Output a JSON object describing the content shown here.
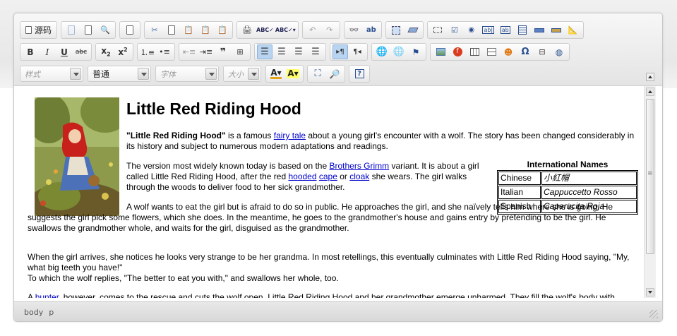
{
  "toolbar": {
    "source_label": "源码",
    "format_combo": "样式",
    "paragraph_combo": "普通",
    "font_combo": "字体",
    "size_combo": "大小"
  },
  "content": {
    "title": "Little Red Riding Hood",
    "p1": {
      "bold": "\"Little Red Riding Hood\"",
      "t1": " is a famous ",
      "link1": "fairy tale",
      "t2": " about a young girl's encounter with a wolf. The story has been changed considerably in its history and subject to numerous modern adaptations and readings."
    },
    "p2": {
      "t1": "The version most widely known today is based on the ",
      "link1": "Brothers Grimm",
      "t2": " variant. It is about a girl called Little Red Riding Hood, after the red ",
      "link2": "hooded",
      "link3": "cape",
      "t3": " or ",
      "link4": "cloak",
      "t4": " she wears. The girl walks through the woods to deliver food to her sick grandmother."
    },
    "p3": "A wolf wants to eat the girl but is afraid to do so in public. He approaches the girl, and she naïvely tells him where she is going. He suggests the girl pick some flowers, which she does. In the meantime, he goes to the grandmother's house and gains entry by pretending to be the girl. He swallows the grandmother whole, and waits for the girl, disguised as the grandmother.",
    "p4_l1": "When the girl arrives, she notices he looks very strange to be her grandma. In most retellings, this eventually culminates with Little Red Riding Hood saying, \"My, what big teeth you have!\"",
    "p4_l2": "To which the wolf replies, \"The better to eat you with,\" and swallows her whole, too.",
    "p5": {
      "t1": "A ",
      "link1": "hunter",
      "t2": ", however, comes to the rescue and cuts the wolf open. Little Red Riding Hood and her grandmother emerge unharmed. They fill the wolf's body with"
    },
    "names_table": {
      "caption": "International Names",
      "rows": [
        {
          "lang": "Chinese",
          "name": "小紅帽"
        },
        {
          "lang": "Italian",
          "name": "Cappuccetto Rosso"
        },
        {
          "lang": "Spanish",
          "name": "Caperucita Roja"
        }
      ]
    }
  },
  "statusbar": {
    "path1": "body",
    "path2": "p"
  }
}
